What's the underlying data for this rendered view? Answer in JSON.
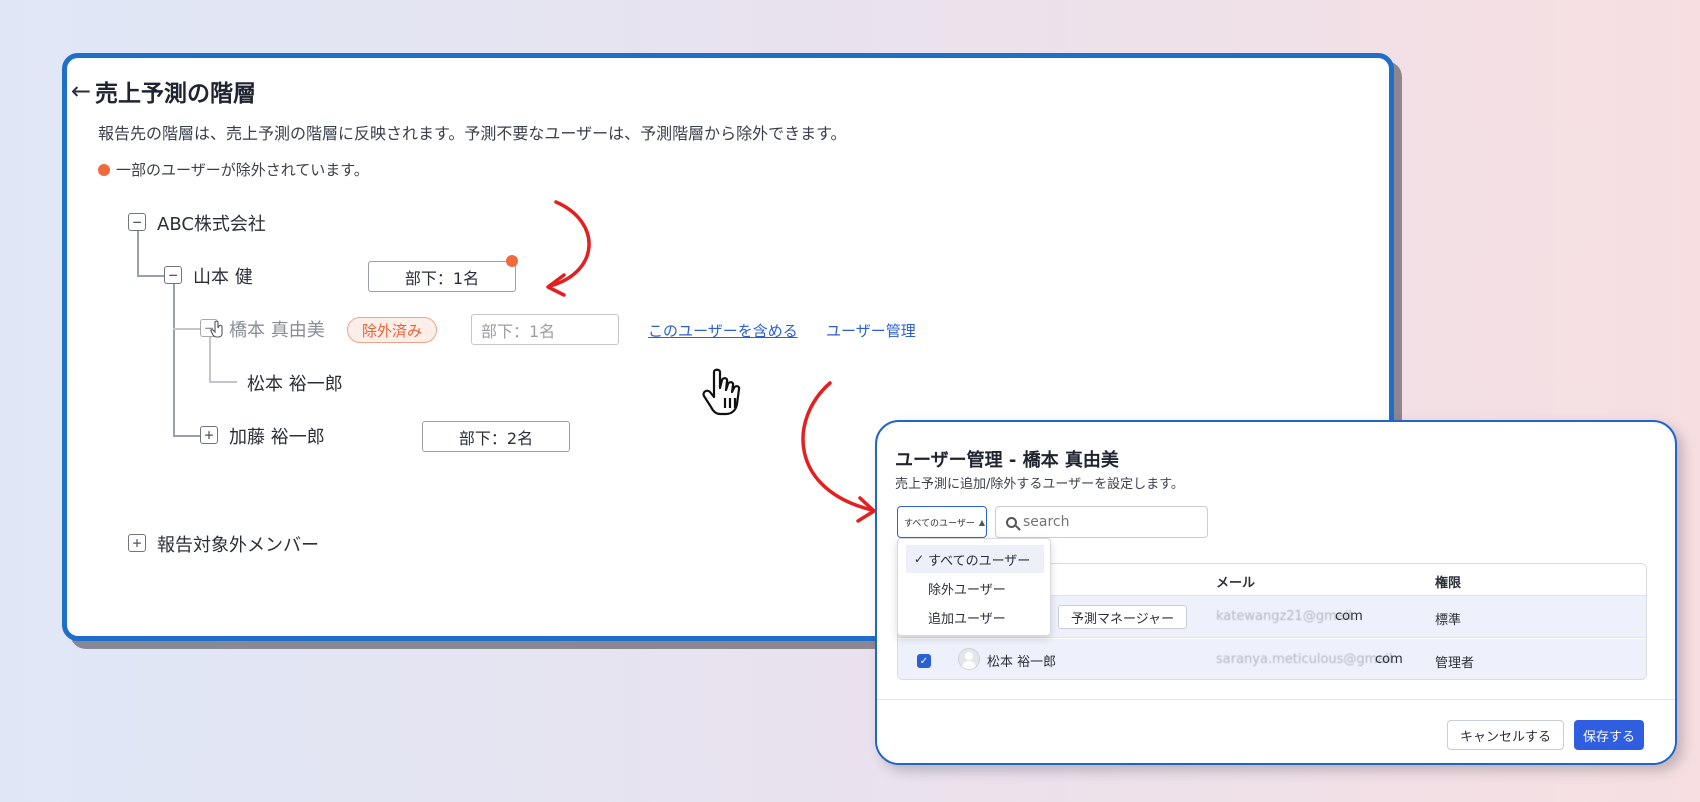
{
  "page": {
    "back_icon": "left-arrow-icon",
    "title": "売上予測の階層",
    "description": "報告先の階層は、売上予測の階層に反映されます。予測不要なユーザーは、予測階層から除外できます。",
    "notice": "一部のユーザーが除外されています。",
    "notice_color": "#ef6a3c"
  },
  "tree": {
    "root": {
      "label": "ABC株式会社",
      "toggle": "−"
    },
    "node_yamamoto": {
      "label": "山本 健",
      "toggle": "−",
      "subordinates": "部下：1名"
    },
    "node_hashimoto": {
      "label": "橋本 真由美",
      "toggle": "−",
      "badge": "除外済み",
      "subordinates": "部下：1名",
      "include_link": "このユーザーを含める",
      "manage_link": "ユーザー管理"
    },
    "node_matsumoto": {
      "label": "松本 裕一郎"
    },
    "node_kato": {
      "label": "加藤 裕一郎",
      "toggle": "+",
      "subordinates": "部下：2名"
    },
    "excluded_members": {
      "label": "報告対象外メンバー",
      "toggle": "+"
    }
  },
  "modal": {
    "title": "ユーザー管理 - 橋本 真由美",
    "subtitle": "売上予測に追加/除外するユーザーを設定します。",
    "filter_value": "すべてのユーザー",
    "search_placeholder": "search",
    "dropdown_options": [
      {
        "label": "すべてのユーザー",
        "selected": true
      },
      {
        "label": "除外ユーザー",
        "selected": false
      },
      {
        "label": "追加ユーザー",
        "selected": false
      }
    ],
    "columns": {
      "email": "メール",
      "permission": "権限"
    },
    "rows": [
      {
        "role_tag": "予測マネージャー",
        "email_local": "katewangz21@gmail.",
        "email_tld": "com",
        "permission": "標準"
      },
      {
        "name": "松本 裕一郎",
        "email_local": "saranya.meticulous@gmail.",
        "email_tld": "com",
        "permission": "管理者",
        "checked": true
      }
    ],
    "cancel_label": "キャンセルする",
    "save_label": "保存する"
  },
  "colors": {
    "accent_blue": "#2a5fd6",
    "window_border": "#1f6fc9",
    "annotation_red": "#e41f1f",
    "excluded_orange": "#e8623a"
  }
}
